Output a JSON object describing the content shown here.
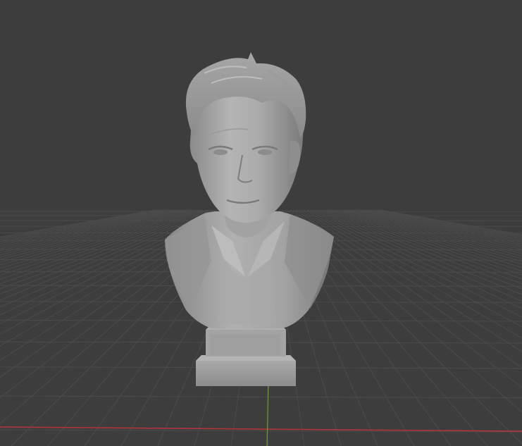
{
  "viewport": {
    "background_color": "#3d3d3d",
    "grid_color": "#4b4b4b",
    "x_axis_color": "#b8343c",
    "y_axis_color": "#6e9b28"
  },
  "scene": {
    "object_name": "bust-sculpture",
    "object_color": "#9e9e9e",
    "shading": "solid"
  }
}
